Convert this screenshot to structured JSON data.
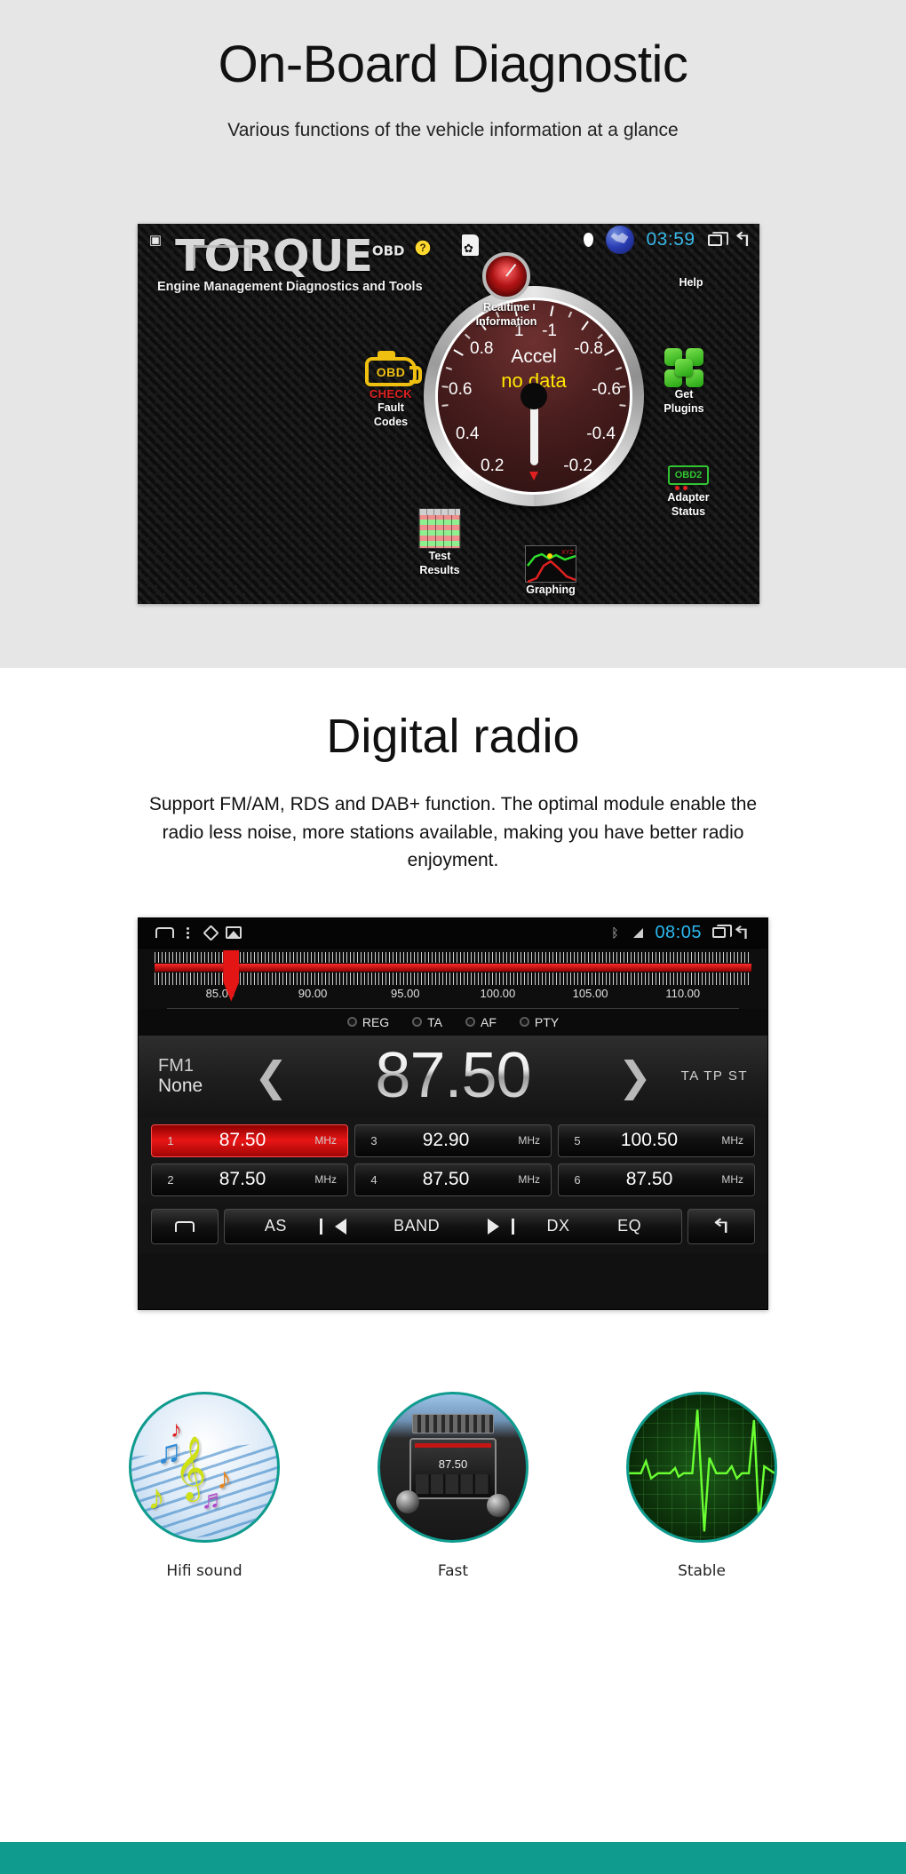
{
  "obd": {
    "title": "On-Board Diagnostic",
    "subtitle": "Various functions of the vehicle information at a glance",
    "statusbar": {
      "clock": "03:59",
      "icons": [
        "image-icon",
        "brightness-help-icon",
        "sd-card-settings-icon",
        "location-pin-icon",
        "globe-icon",
        "recents-icon",
        "back-icon"
      ]
    },
    "app": {
      "logo": "TORQUE",
      "logo_sup": "OBD",
      "tagline": "Engine Management Diagnostics and Tools"
    },
    "tiles": [
      {
        "id": "realtime",
        "label_line1": "Realtime",
        "label_line2": "Information",
        "icon": "gauge-icon"
      },
      {
        "id": "help",
        "label_line1": "Help",
        "label_line2": "",
        "icon": "globe-icon"
      },
      {
        "id": "fault-codes",
        "badge": "OBD",
        "check": "CHECK",
        "label_line1": "Fault",
        "label_line2": "Codes",
        "icon": "check-engine-icon"
      },
      {
        "id": "get-plugins",
        "label_line1": "Get",
        "label_line2": "Plugins",
        "icon": "puzzle-icon"
      },
      {
        "id": "test-results",
        "label_line1": "Test",
        "label_line2": "Results",
        "icon": "table-icon"
      },
      {
        "id": "adapter-status",
        "badge": "OBD2",
        "label_line1": "Adapter",
        "label_line2": "Status",
        "icon": "adapter-icon"
      },
      {
        "id": "graphing",
        "label_line1": "Graphing",
        "label_line2": "",
        "icon": "graph-icon"
      }
    ],
    "gauge": {
      "label": "Accel",
      "value_text": "no data",
      "ticks": [
        "1",
        "0.8",
        "0.6",
        "0.4",
        "0.2",
        "-1",
        "-0.8",
        "-0.6",
        "-0.4",
        "-0.2"
      ]
    }
  },
  "radio": {
    "title": "Digital radio",
    "description": "Support FM/AM, RDS and DAB+ function. The optimal module enable the radio less noise, more stations available, making you have better radio enjoyment.",
    "statusbar": {
      "clock": "08:05",
      "icons": [
        "home-icon",
        "menu-dots-icon",
        "diamond-icon",
        "picture-icon",
        "bluetooth-icon",
        "signal-icon",
        "recents-icon",
        "back-icon"
      ]
    },
    "scale": {
      "ticks": [
        "85.00",
        "90.00",
        "95.00",
        "100.00",
        "105.00",
        "110.00"
      ],
      "marker_percent": 11.5
    },
    "rds": [
      {
        "label": "REG",
        "on": false
      },
      {
        "label": "TA",
        "on": false
      },
      {
        "label": "AF",
        "on": false
      },
      {
        "label": "PTY",
        "on": false
      }
    ],
    "display": {
      "band": "FM1",
      "station_name": "None",
      "frequency": "87.50",
      "prev_icon": "chevron-left-icon",
      "next_icon": "chevron-right-icon",
      "indicators": "TA TP ST"
    },
    "presets": [
      {
        "num": "1",
        "freq": "87.50",
        "unit": "MHz",
        "active": true
      },
      {
        "num": "3",
        "freq": "92.90",
        "unit": "MHz",
        "active": false
      },
      {
        "num": "5",
        "freq": "100.50",
        "unit": "MHz",
        "active": false
      },
      {
        "num": "2",
        "freq": "87.50",
        "unit": "MHz",
        "active": false
      },
      {
        "num": "4",
        "freq": "87.50",
        "unit": "MHz",
        "active": false
      },
      {
        "num": "6",
        "freq": "87.50",
        "unit": "MHz",
        "active": false
      }
    ],
    "toolbar": {
      "home_icon": "home-icon",
      "as_label": "AS",
      "prev_icon": "skip-previous-icon",
      "band_label": "BAND",
      "next_icon": "skip-next-icon",
      "dx_label": "DX",
      "eq_label": "EQ",
      "back_icon": "back-icon"
    }
  },
  "features": [
    {
      "label": "Hifi sound",
      "image": "music-notes-image"
    },
    {
      "label": "Fast",
      "image": "car-dashboard-image"
    },
    {
      "label": "Stable",
      "image": "ecg-waveform-image"
    }
  ],
  "colors": {
    "accent_teal": "#0f9b8e",
    "section_bg": "#e6e6e6",
    "clock_blue": "#2bb8f0",
    "preset_active_red": "#e81515"
  }
}
